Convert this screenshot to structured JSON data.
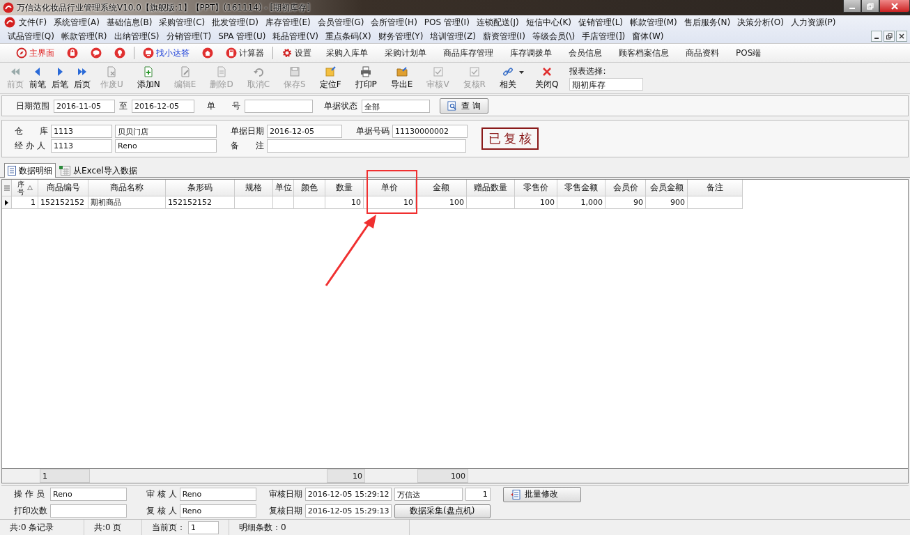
{
  "window": {
    "title": "万信达化妆品行业管理系统V10.0【旗舰版:1】【PPT】(161114) - [期初库存]"
  },
  "menu_rows": [
    [
      "文件(F)",
      "系统管理(A)",
      "基础信息(B)",
      "采购管理(C)",
      "批发管理(D)",
      "库存管理(E)",
      "会员管理(G)",
      "会所管理(H)",
      "POS 管理(I)",
      "连锁配送(J)",
      "短信中心(K)",
      "促销管理(L)",
      "帐款管理(M)",
      "售后服务(N)",
      "决策分析(O)",
      "人力资源(P)"
    ],
    [
      "试品管理(Q)",
      "帐款管理(R)",
      "出纳管理(S)",
      "分销管理(T)",
      "SPA 管理(U)",
      "耗品管理(V)",
      "重点条码(X)",
      "财务管理(Y)",
      "培训管理(Z)",
      "薪资管理(I)",
      "等级会员(\\)",
      "手店管理(])",
      "窗体(W)"
    ]
  ],
  "shortcuts": [
    {
      "kind": "icon-text",
      "label": "主界面"
    },
    {
      "kind": "icon"
    },
    {
      "kind": "icon"
    },
    {
      "kind": "icon"
    },
    {
      "kind": "icon-text",
      "label": "找小达答"
    },
    {
      "kind": "icon"
    },
    {
      "kind": "icon-text",
      "label": "计算器"
    },
    {
      "kind": "icon-text",
      "label": "设置"
    },
    {
      "kind": "text",
      "label": "采购入库单"
    },
    {
      "kind": "text",
      "label": "采购计划单"
    },
    {
      "kind": "text",
      "label": "商品库存管理"
    },
    {
      "kind": "text",
      "label": "库存调拨单"
    },
    {
      "kind": "text",
      "label": "会员信息"
    },
    {
      "kind": "text",
      "label": "顾客档案信息"
    },
    {
      "kind": "text",
      "label": "商品资料"
    },
    {
      "kind": "text",
      "label": "POS端"
    }
  ],
  "toolbar": [
    {
      "label": "前页",
      "disabled": true
    },
    {
      "label": "前笔",
      "disabled": false
    },
    {
      "label": "后笔",
      "disabled": false
    },
    {
      "label": "后页",
      "disabled": false
    },
    {
      "label": "作废U",
      "disabled": true
    },
    {
      "label": "添加N",
      "disabled": false
    },
    {
      "label": "编辑E",
      "disabled": true
    },
    {
      "label": "删除D",
      "disabled": true
    },
    {
      "label": "取消C",
      "disabled": true
    },
    {
      "label": "保存S",
      "disabled": true
    },
    {
      "label": "定位F",
      "disabled": false
    },
    {
      "label": "打印P",
      "disabled": false
    },
    {
      "label": "导出E",
      "disabled": false
    },
    {
      "label": "审核V",
      "disabled": true
    },
    {
      "label": "复核R",
      "disabled": true
    },
    {
      "label": "相关",
      "disabled": false
    },
    {
      "label": "关闭Q",
      "disabled": false
    }
  ],
  "report_select": {
    "label": "报表选择:",
    "value": "期初库存"
  },
  "filter": {
    "date_label": "日期范围",
    "date_from": "2016-11-05",
    "to_label": "至",
    "date_to": "2016-12-05",
    "number_label": "单　　号",
    "status_label": "单据状态",
    "status_value": "全部",
    "query_button": "查 询"
  },
  "form": {
    "warehouse_label": "仓　　库",
    "warehouse_code": "1113",
    "warehouse_name": "贝贝门店",
    "date_label": "单据日期",
    "date_value": "2016-12-05",
    "number_label": "单据号码",
    "number_value": "11130000002",
    "handler_label": "经 办 人",
    "handler_code": "1113",
    "handler_name": "Reno",
    "remark_label": "备　　注",
    "stamp": "已复核"
  },
  "tabs": [
    {
      "label": "数据明细",
      "selected": true
    },
    {
      "label": "从Excel导入数据",
      "selected": false
    }
  ],
  "table": {
    "columns": [
      "序号",
      "商品编号",
      "商品名称",
      "条形码",
      "规格",
      "单位",
      "颜色",
      "数量",
      "单价",
      "金额",
      "赠品数量",
      "零售价",
      "零售金额",
      "会员价",
      "会员金额",
      "备注"
    ],
    "rows": [
      {
        "selected": true,
        "seq": "1",
        "code": "152152152",
        "name": "期初商品",
        "barcode": "152152152",
        "quantity": "10",
        "unit_price": "10",
        "amount": "100",
        "retail_price": "100",
        "retail_amount": "1,000",
        "member_price": "90",
        "member_amount": "900"
      }
    ],
    "footer": {
      "code_count": "1",
      "quantity_sum": "10",
      "amount_sum": "100"
    }
  },
  "bottom": {
    "operator_label": "操 作 员",
    "operator": "Reno",
    "auditor_label": "审 核 人",
    "auditor": "Reno",
    "audit_date_label": "审核日期",
    "audit_date": "2016-12-05 15:29:12",
    "company": "万信达",
    "count": "1",
    "batch_button": "批量修改",
    "print_label": "打印次数",
    "reviewer_label": "复 核 人",
    "reviewer": "Reno",
    "review_date_label": "复核日期",
    "review_date": "2016-12-05 15:29:13",
    "collect_button": "数据采集(盘点机)"
  },
  "status_bar": {
    "records": "共:0 条记录",
    "pages": "共:0 页",
    "current_label": "当前页：",
    "current_page": "1",
    "detail_count": "明细条数：0"
  }
}
